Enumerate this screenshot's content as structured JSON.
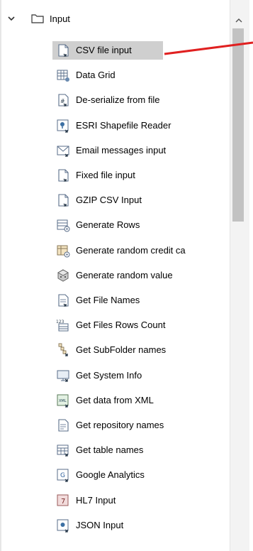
{
  "tree": {
    "group": {
      "label": "Input",
      "expanded": true
    },
    "items": [
      {
        "label": "CSV file input",
        "icon": "csv-file-icon",
        "selected": true
      },
      {
        "label": "Data Grid",
        "icon": "data-grid-icon"
      },
      {
        "label": "De-serialize from file",
        "icon": "deserialize-icon"
      },
      {
        "label": "ESRI Shapefile Reader",
        "icon": "shapefile-icon"
      },
      {
        "label": "Email messages input",
        "icon": "email-icon"
      },
      {
        "label": "Fixed file input",
        "icon": "fixed-file-icon"
      },
      {
        "label": "GZIP CSV Input",
        "icon": "gzip-csv-icon"
      },
      {
        "label": "Generate Rows",
        "icon": "generate-rows-icon"
      },
      {
        "label": "Generate random credit ca",
        "icon": "credit-card-icon"
      },
      {
        "label": "Generate random value",
        "icon": "random-value-icon"
      },
      {
        "label": "Get File Names",
        "icon": "file-names-icon"
      },
      {
        "label": "Get Files Rows Count",
        "icon": "rows-count-icon"
      },
      {
        "label": "Get SubFolder names",
        "icon": "subfolder-icon"
      },
      {
        "label": "Get System Info",
        "icon": "system-info-icon"
      },
      {
        "label": "Get data from XML",
        "icon": "xml-icon"
      },
      {
        "label": "Get repository names",
        "icon": "repository-icon"
      },
      {
        "label": "Get table names",
        "icon": "table-names-icon"
      },
      {
        "label": "Google Analytics",
        "icon": "google-analytics-icon"
      },
      {
        "label": "HL7 Input",
        "icon": "hl7-icon"
      },
      {
        "label": "JSON Input",
        "icon": "json-icon"
      }
    ]
  },
  "colors": {
    "selection": "#cfcfcf",
    "pointer": "#e02020",
    "scroll_thumb": "#c2c2c2"
  }
}
